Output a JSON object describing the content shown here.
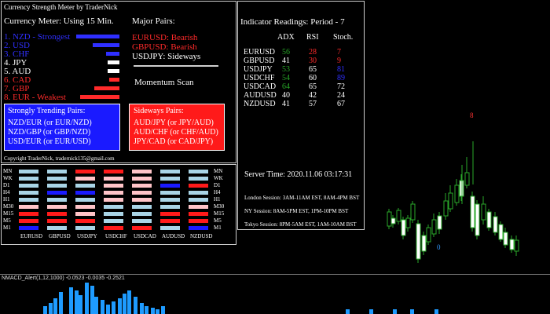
{
  "meter": {
    "title": "Currency Strength Meter by TraderNick",
    "heading": "Currency Meter: Using 15 Min.",
    "currencies": [
      {
        "label": "1. NZD - Strongest",
        "color": "#2f2fff",
        "bar_color": "#2f2fff",
        "bar_value": 1.0
      },
      {
        "label": "2. USD",
        "color": "#2f2fff",
        "bar_color": "#2f2fff",
        "bar_value": 0.62
      },
      {
        "label": "3. CHF",
        "color": "#2f2fff",
        "bar_color": "#2f2fff",
        "bar_value": 0.3
      },
      {
        "label": "4. JPY",
        "color": "#ffffff",
        "bar_color": "#ffffff",
        "bar_value": 0.28
      },
      {
        "label": "5. AUD",
        "color": "#ffffff",
        "bar_color": "#ffffff",
        "bar_value": 0.27
      },
      {
        "label": "6. CAD",
        "color": "#ff2a2a",
        "bar_color": "#ff2a2a",
        "bar_value": 0.24
      },
      {
        "label": "7. GBP",
        "color": "#ff2a2a",
        "bar_color": "#ff2a2a",
        "bar_value": 0.58
      },
      {
        "label": "8. EUR - Weakest",
        "color": "#ff2a2a",
        "bar_color": "#ff2a2a",
        "bar_value": 0.9
      }
    ],
    "major_heading": "Major Pairs:",
    "major_pairs": [
      {
        "text": "EURUSD: Bearish",
        "color": "#ff2a2a"
      },
      {
        "text": "GBPUSD: Bearish",
        "color": "#ff2a2a"
      },
      {
        "text": "USDJPY: Sideways",
        "color": "#ffffff"
      }
    ],
    "momentum_label": "Momentum Scan",
    "trending": {
      "heading": "Strongly Trending Pairs:",
      "items": [
        "NZD/EUR (or EUR/NZD)",
        "NZD/GBP (or GBP/NZD)",
        "USD/EUR (or EUR/USD)"
      ],
      "bg": "#1a1aff"
    },
    "sideways": {
      "heading": "Sideways Pairs:",
      "items": [
        "AUD/JPY (or JPY/AUD)",
        "AUD/CHF (or CHF/AUD)",
        "JPY/CAD (or CAD/JPY)"
      ],
      "bg": "#ff1a1a"
    },
    "copyright": "Copyright TraderNick, tradernick135@gmail.com"
  },
  "grid": {
    "timeframes": [
      "MN",
      "WK",
      "D1",
      "H4",
      "H1",
      "M30",
      "M15",
      "M5",
      "M1"
    ],
    "pairs": [
      "EURUSD",
      "GBPUSD",
      "USDJPY",
      "USDCHF",
      "USDCAD",
      "AUDUSD",
      "NZDUSD"
    ],
    "colors": {
      "L": "#a9d4e6",
      "B": "#1a1aff",
      "R": "#ff1a1a",
      "P": "#ffc4c8"
    },
    "cells": [
      [
        "L",
        "L",
        "R",
        "R",
        "P",
        "L",
        "L"
      ],
      [
        "L",
        "L",
        "P",
        "P",
        "P",
        "L",
        "L"
      ],
      [
        "L",
        "L",
        "L",
        "P",
        "P",
        "B",
        "R"
      ],
      [
        "L",
        "B",
        "B",
        "P",
        "P",
        "L",
        "L"
      ],
      [
        "L",
        "L",
        "L",
        "P",
        "P",
        "L",
        "L"
      ],
      [
        "P",
        "P",
        "P",
        "L",
        "L",
        "L",
        "P"
      ],
      [
        "R",
        "R",
        "P",
        "L",
        "L",
        "R",
        "R"
      ],
      [
        "R",
        "R",
        "R",
        "L",
        "L",
        "R",
        "R"
      ],
      [
        "B",
        "L",
        "L",
        "R",
        "R",
        "L",
        "B"
      ]
    ]
  },
  "indicators": {
    "title": "Indicator Readings: Period - 7",
    "columns": [
      "ADX",
      "RSI",
      "Stoch."
    ],
    "rows": [
      {
        "pair": "EURUSD",
        "adx": "56",
        "adx_color": "#27a427",
        "rsi": "28",
        "rsi_color": "#ff2a2a",
        "stoch": "7",
        "stoch_color": "#ff2a2a"
      },
      {
        "pair": "GBPUSD",
        "adx": "41",
        "adx_color": "#ffffff",
        "rsi": "30",
        "rsi_color": "#ff2a2a",
        "stoch": "9",
        "stoch_color": "#ff2a2a"
      },
      {
        "pair": "USDJPY",
        "adx": "53",
        "adx_color": "#27a427",
        "rsi": "65",
        "rsi_color": "#ffffff",
        "stoch": "81",
        "stoch_color": "#2f2fff"
      },
      {
        "pair": "USDCHF",
        "adx": "54",
        "adx_color": "#27a427",
        "rsi": "60",
        "rsi_color": "#ffffff",
        "stoch": "89",
        "stoch_color": "#2f2fff"
      },
      {
        "pair": "USDCAD",
        "adx": "64",
        "adx_color": "#27a427",
        "rsi": "65",
        "rsi_color": "#ffffff",
        "stoch": "72",
        "stoch_color": "#ffffff"
      },
      {
        "pair": "AUDUSD",
        "adx": "40",
        "adx_color": "#ffffff",
        "rsi": "42",
        "rsi_color": "#ffffff",
        "stoch": "24",
        "stoch_color": "#ffffff"
      },
      {
        "pair": "NZDUSD",
        "adx": "41",
        "adx_color": "#ffffff",
        "rsi": "57",
        "rsi_color": "#ffffff",
        "stoch": "67",
        "stoch_color": "#ffffff"
      }
    ]
  },
  "server": {
    "time": "Server Time: 2020.11.06 03:17:31",
    "sessions": [
      "London Session: 3AM-11AM EST, 8AM-4PM BST",
      "NY Session: 8AM-5PM EST, 1PM-10PM BST",
      "Tokyo Session: 8PM-5AM EST, 1AM-10AM BST"
    ]
  },
  "chart": {
    "marker_top": "8",
    "marker_bottom": "0",
    "marker_top_color": "#ff3333",
    "marker_bottom_color": "#3399ff"
  },
  "macd": {
    "label": "NMACD_Alert(1,12,1000) -0.0523 -0.0035 -0.2521",
    "bar_color": "#1e9bff"
  }
}
